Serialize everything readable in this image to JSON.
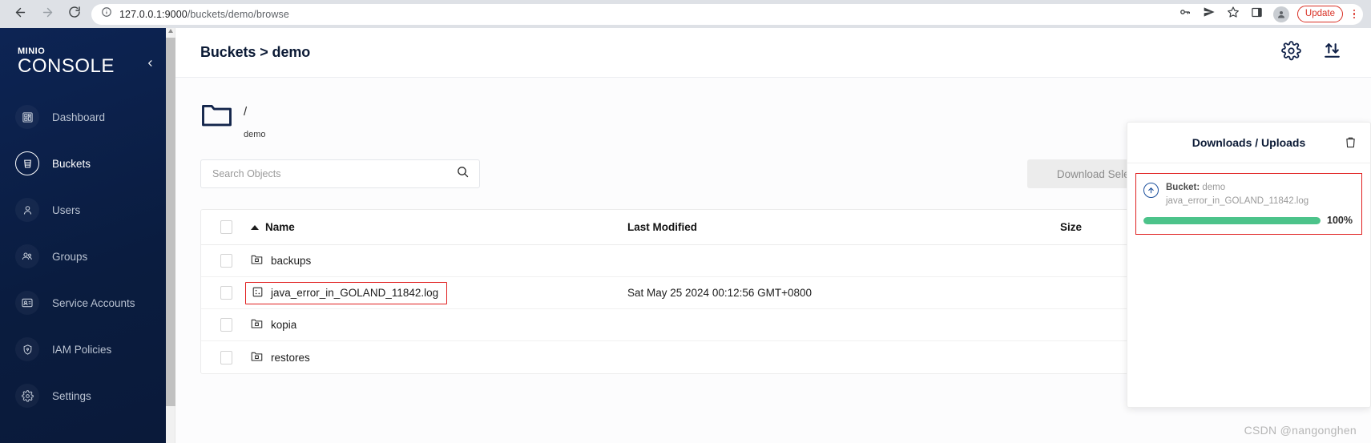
{
  "browser": {
    "url_host": "127.0.0.1:9000",
    "url_path": "/buckets/demo/browse",
    "back_icon": "back-arrow-icon",
    "forward_icon": "forward-arrow-icon",
    "reload_icon": "reload-icon",
    "info_icon": "site-info-icon",
    "password_icon": "key-icon",
    "share_icon": "send-icon",
    "bookmark_icon": "star-icon",
    "sidepanel_icon": "side-panel-icon",
    "profile_icon": "profile-avatar-icon",
    "update_label": "Update",
    "menu_icon": "vertical-dots-icon",
    "accent_red": "#d93025"
  },
  "sidebar": {
    "logo_top": "MINIO",
    "logo_bottom": "CONSOLE",
    "collapse_icon": "chevron-left-icon",
    "background": "#0a1c42",
    "items": [
      {
        "label": "Dashboard",
        "icon": "dashboard-icon",
        "active": false
      },
      {
        "label": "Buckets",
        "icon": "bucket-icon",
        "active": true
      },
      {
        "label": "Users",
        "icon": "user-icon",
        "active": false
      },
      {
        "label": "Groups",
        "icon": "groups-icon",
        "active": false
      },
      {
        "label": "Service Accounts",
        "icon": "id-card-icon",
        "active": false
      },
      {
        "label": "IAM Policies",
        "icon": "shield-lock-icon",
        "active": false
      },
      {
        "label": "Settings",
        "icon": "gear-icon",
        "active": false
      }
    ]
  },
  "header": {
    "title": "Buckets > demo",
    "settings_icon": "gear-icon",
    "transfer_icon": "upload-download-icon"
  },
  "path": {
    "folder_icon": "folder-icon",
    "separator": "/",
    "bucket": "demo"
  },
  "search": {
    "placeholder": "Search Objects",
    "value": "",
    "icon": "search-icon"
  },
  "actions": {
    "download_label": "Download Selected"
  },
  "table": {
    "columns": {
      "name": "Name",
      "last_modified": "Last Modified",
      "size": "Size"
    },
    "sort_icon": "sort-ascending-caret",
    "rows": [
      {
        "name": "backups",
        "icon": "folder-icon",
        "last_modified": "",
        "size": "",
        "highlighted": false
      },
      {
        "name": "java_error_in_GOLAND_11842.log",
        "icon": "file-icon",
        "last_modified": "Sat May 25 2024 00:12:56 GMT+0800",
        "size": "",
        "highlighted": true
      },
      {
        "name": "kopia",
        "icon": "folder-icon",
        "last_modified": "",
        "size": "",
        "highlighted": false
      },
      {
        "name": "restores",
        "icon": "folder-icon",
        "last_modified": "",
        "size": "",
        "highlighted": false
      }
    ]
  },
  "downloads_panel": {
    "title": "Downloads / Uploads",
    "trash_icon": "trash-icon",
    "item": {
      "direction_icon": "upload-arrow-circle-icon",
      "bucket_label": "Bucket:",
      "bucket_name": "demo",
      "file_name": "java_error_in_GOLAND_11842.log",
      "progress": 100,
      "progress_label": "100%",
      "progress_color": "#4cc38a"
    }
  },
  "watermark": "CSDN @nangonghen"
}
